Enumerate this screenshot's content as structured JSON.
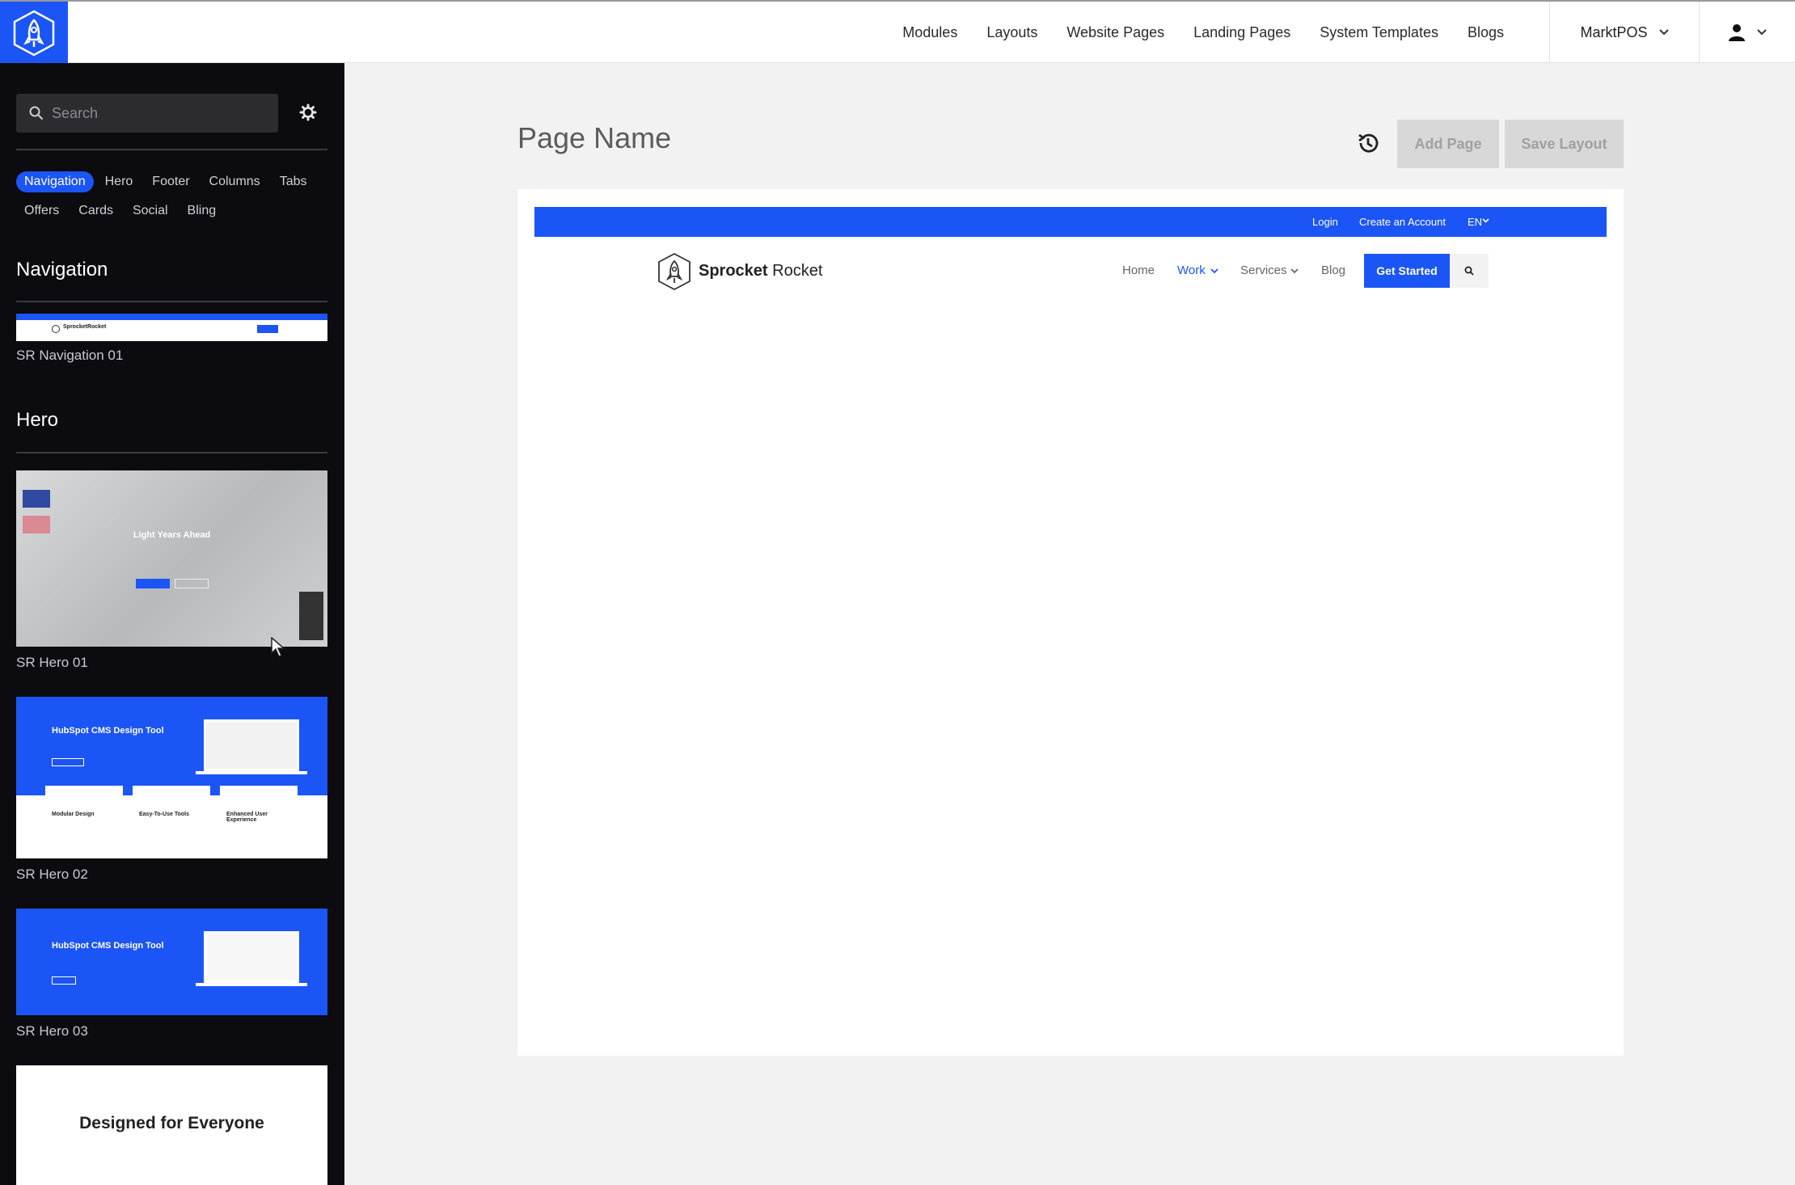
{
  "topnav": {
    "links": [
      "Modules",
      "Layouts",
      "Website Pages",
      "Landing Pages",
      "System Templates",
      "Blogs"
    ],
    "portal": "MarktPOS"
  },
  "colors": {
    "brand_blue": "#1c55f5",
    "sidebar_bg": "#0b0b10"
  },
  "sidebar": {
    "search_placeholder": "Search",
    "filters": [
      "Navigation",
      "Hero",
      "Footer",
      "Columns",
      "Tabs",
      "Offers",
      "Cards",
      "Social",
      "Bling"
    ],
    "active_filter": "Navigation",
    "sections": {
      "navigation": {
        "title": "Navigation",
        "items": [
          "SR Navigation 01"
        ]
      },
      "hero": {
        "title": "Hero",
        "items": [
          "SR Hero 01",
          "SR Hero 02",
          "SR Hero 03"
        ]
      }
    },
    "thumbs": {
      "nav01_brand": "SprocketRocket",
      "hero01_heading": "Light Years Ahead",
      "hero02_heading": "HubSpot CMS Design Tool",
      "hero02_cards": [
        "Modular Design",
        "Easy-To-Use Tools",
        "Enhanced User Experience"
      ],
      "hero03_heading": "HubSpot CMS Design Tool",
      "next_heading": "Designed for Everyone"
    }
  },
  "main": {
    "page_title": "Page Name",
    "add_page": "Add Page",
    "save_layout": "Save Layout"
  },
  "preview": {
    "utility": {
      "login": "Login",
      "create": "Create an Account",
      "lang": "EN"
    },
    "brand_bold": "Sprocket",
    "brand_light": "Rocket",
    "nav": {
      "home": "Home",
      "work": "Work",
      "services": "Services",
      "blog": "Blog"
    },
    "cta": "Get Started"
  }
}
